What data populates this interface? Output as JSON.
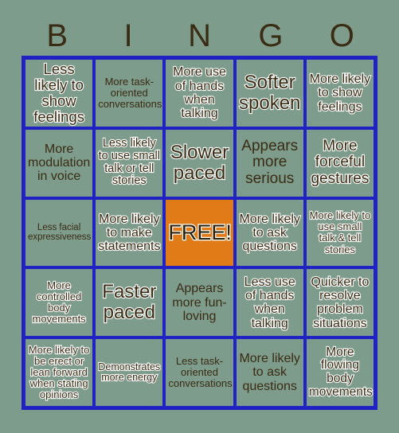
{
  "card": {
    "title_letters": [
      "B",
      "I",
      "N",
      "G",
      "O"
    ],
    "background_color": "#7e9c8b",
    "border_color": "#2222c4",
    "text_color": "#3a2b13",
    "free_color": "#e07b18",
    "grid_size": "5x5"
  },
  "cells": [
    {
      "text": "Less likely to show feelings",
      "style": "outlined",
      "size": "lg",
      "free": false
    },
    {
      "text": "More task-oriented conversations",
      "style": "plain",
      "size": "sm",
      "free": false
    },
    {
      "text": "More use of hands when talking",
      "style": "outlined",
      "size": "md",
      "free": false
    },
    {
      "text": "Softer spoken",
      "style": "outlined",
      "size": "xl",
      "free": false
    },
    {
      "text": "More likely to show feelings",
      "style": "outlined",
      "size": "md",
      "free": false
    },
    {
      "text": "More modulation in voice",
      "style": "plain",
      "size": "lg",
      "free": false
    },
    {
      "text": "Less likely to use small talk or tell stories",
      "style": "outlined",
      "size": "md",
      "free": false
    },
    {
      "text": "Slower paced",
      "style": "outlined",
      "size": "xl",
      "free": false
    },
    {
      "text": "Appears more serious",
      "style": "plain",
      "size": "lg",
      "free": false
    },
    {
      "text": "More forceful gestures",
      "style": "outlined",
      "size": "lg",
      "free": false
    },
    {
      "text": "Less facial expressiveness",
      "style": "plain",
      "size": "xs",
      "free": false
    },
    {
      "text": "More likely to make statements",
      "style": "outlined",
      "size": "md",
      "free": false
    },
    {
      "text": "FREE!",
      "style": "outlined",
      "size": "xxl",
      "free": true
    },
    {
      "text": "More likely to ask questions",
      "style": "outlined",
      "size": "md",
      "free": false
    },
    {
      "text": "More likely to use small talk & tell stories",
      "style": "outlined",
      "size": "sm",
      "free": false
    },
    {
      "text": "More controlled body movements",
      "style": "outlined",
      "size": "sm",
      "free": false
    },
    {
      "text": "Faster paced",
      "style": "outlined",
      "size": "xl",
      "free": false
    },
    {
      "text": "Appears more fun-loving",
      "style": "plain",
      "size": "md",
      "free": false
    },
    {
      "text": "Less use of hands when talking",
      "style": "outlined",
      "size": "md",
      "free": false
    },
    {
      "text": "Quicker to resolve problem situations",
      "style": "outlined",
      "size": "md",
      "free": false
    },
    {
      "text": "More likely to be erect or lean forward when stating opinions",
      "style": "outlined",
      "size": "sm",
      "free": false
    },
    {
      "text": "Demonstrates more energy",
      "style": "outlined",
      "size": "sm",
      "free": false
    },
    {
      "text": "Less task-oriented conversations",
      "style": "plain",
      "size": "sm",
      "free": false
    },
    {
      "text": "More likely to ask questions",
      "style": "plain",
      "size": "md",
      "free": false
    },
    {
      "text": "More flowing body movements",
      "style": "outlined",
      "size": "md",
      "free": false
    }
  ]
}
